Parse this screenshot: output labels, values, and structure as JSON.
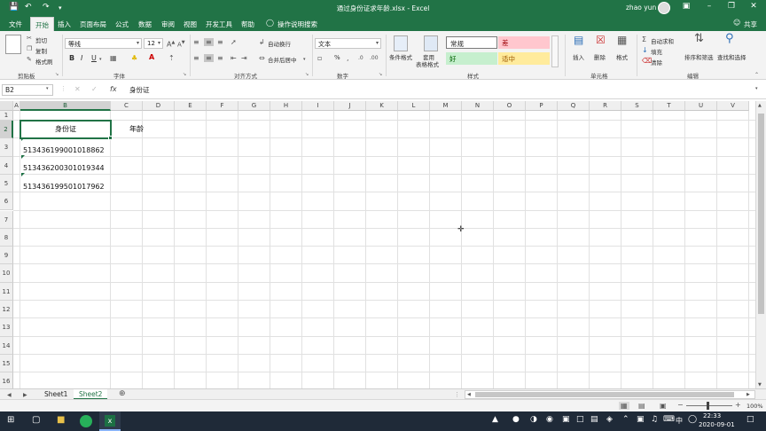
{
  "window": {
    "title": "通过身份证求年龄.xlsx - Excel",
    "user": "zhao yun"
  },
  "ribbon_tabs": [
    "文件",
    "开始",
    "插入",
    "页面布局",
    "公式",
    "数据",
    "审阅",
    "视图",
    "开发工具",
    "帮助",
    "操作说明搜索"
  ],
  "active_tab": "开始",
  "share_label": "共享",
  "clipboard": {
    "cut": "剪切",
    "copy": "复制",
    "format_painter": "格式刷",
    "group": "剪贴板"
  },
  "font": {
    "name": "等线",
    "size": "12",
    "group": "字体",
    "bold": "B",
    "italic": "I",
    "underline": "U"
  },
  "alignment": {
    "wrap": "自动换行",
    "merge": "合并后居中",
    "group": "对齐方式"
  },
  "number": {
    "format": "文本",
    "percent": "%",
    "group": "数字"
  },
  "styles": {
    "conditional": "条件格式",
    "table": "套用\n表格格式",
    "normal": "常规",
    "bad": "差",
    "good": "好",
    "neutral": "适中",
    "group": "样式"
  },
  "cells": {
    "insert": "插入",
    "delete": "删除",
    "format": "格式",
    "group": "单元格"
  },
  "editing": {
    "autosum": "自动求和",
    "fill": "填充",
    "clear": "清除",
    "sort": "排序和筛选",
    "find": "查找和选择",
    "group": "编辑"
  },
  "formula_bar": {
    "name_box": "B2",
    "fx": "fx",
    "content": "身份证"
  },
  "columns": [
    "A",
    "B",
    "C",
    "D",
    "E",
    "F",
    "G",
    "H",
    "I",
    "J",
    "K",
    "L",
    "M",
    "N",
    "O",
    "P",
    "Q",
    "R",
    "S",
    "T",
    "U",
    "V"
  ],
  "rows": [
    "1",
    "2",
    "3",
    "4",
    "5",
    "6",
    "7",
    "8",
    "9",
    "10",
    "11",
    "12",
    "13",
    "14",
    "15",
    "16"
  ],
  "cells_data": {
    "B2": "身份证",
    "C2": "年龄",
    "B3": "513436199001018862",
    "B4": "513436200301019344",
    "B5": "513436199501017962"
  },
  "sheets": [
    "Sheet1",
    "Sheet2"
  ],
  "active_sheet": "Sheet2",
  "status": {
    "zoom": "100%"
  },
  "taskbar": {
    "time": "22:33",
    "date": "2020-09-01",
    "ime": "中"
  },
  "colors": {
    "excel_green": "#217346",
    "taskbar": "#1f2a38",
    "bad_bg": "#ffc7ce",
    "bad_fg": "#9c0006",
    "good_bg": "#c6efce",
    "good_fg": "#006100",
    "neutral_bg": "#ffeb9c",
    "neutral_fg": "#9c5700"
  }
}
